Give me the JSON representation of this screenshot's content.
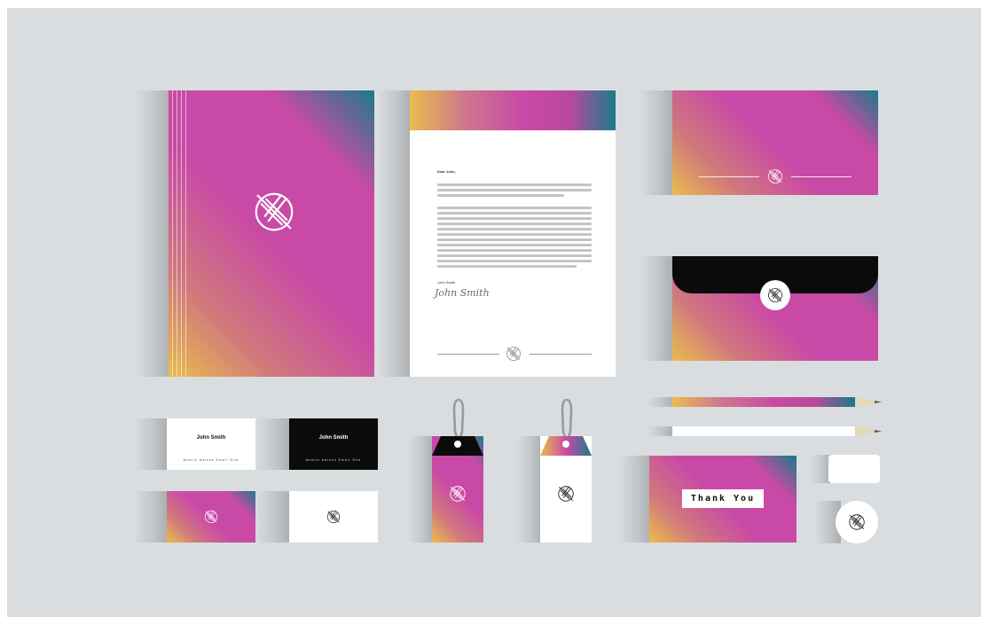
{
  "letter": {
    "greeting": "Dear John,",
    "signature_name": "John Smith",
    "signature_script": "John Smith"
  },
  "business_card_white": {
    "name": "John Smith",
    "subline": "Mobile Adress Email Site"
  },
  "business_card_black": {
    "name": "John Smith",
    "subline": "Mobile Adress Email Site"
  },
  "thank_you_card": {
    "label": "Thank You"
  },
  "icons": {
    "logo": "logo-mark-icon"
  },
  "colors": {
    "background": "#d9dde0",
    "gradient_teal": "#1b7b8a",
    "gradient_magenta": "#c94aa6",
    "gradient_yellow": "#eabd4c",
    "black": "#0b0b0b",
    "white": "#ffffff"
  }
}
